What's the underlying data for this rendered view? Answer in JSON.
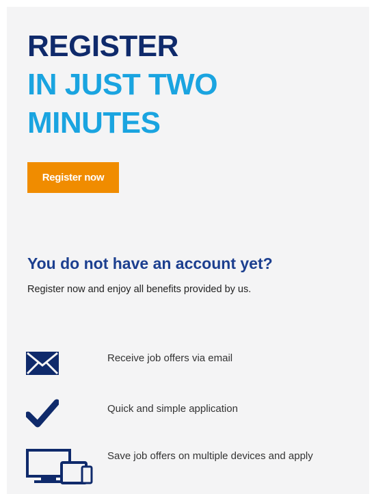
{
  "theme": {
    "navy": "#0f2a6b",
    "navy2": "#1c3f8f",
    "sky": "#1aa4e0",
    "orange": "#f08c00"
  },
  "hero": {
    "line1": "REGISTER",
    "line2": "IN JUST TWO",
    "line3": "MINUTES"
  },
  "cta": {
    "label": "Register now"
  },
  "account": {
    "title": "You do not have an account yet?",
    "text": "Register now and enjoy all benefits provided by us."
  },
  "benefits": [
    {
      "icon": "envelope-icon",
      "label": "Receive job offers via email"
    },
    {
      "icon": "checkmark-icon",
      "label": "Quick and simple application"
    },
    {
      "icon": "devices-icon",
      "label": "Save job offers on multiple devices and apply"
    }
  ]
}
